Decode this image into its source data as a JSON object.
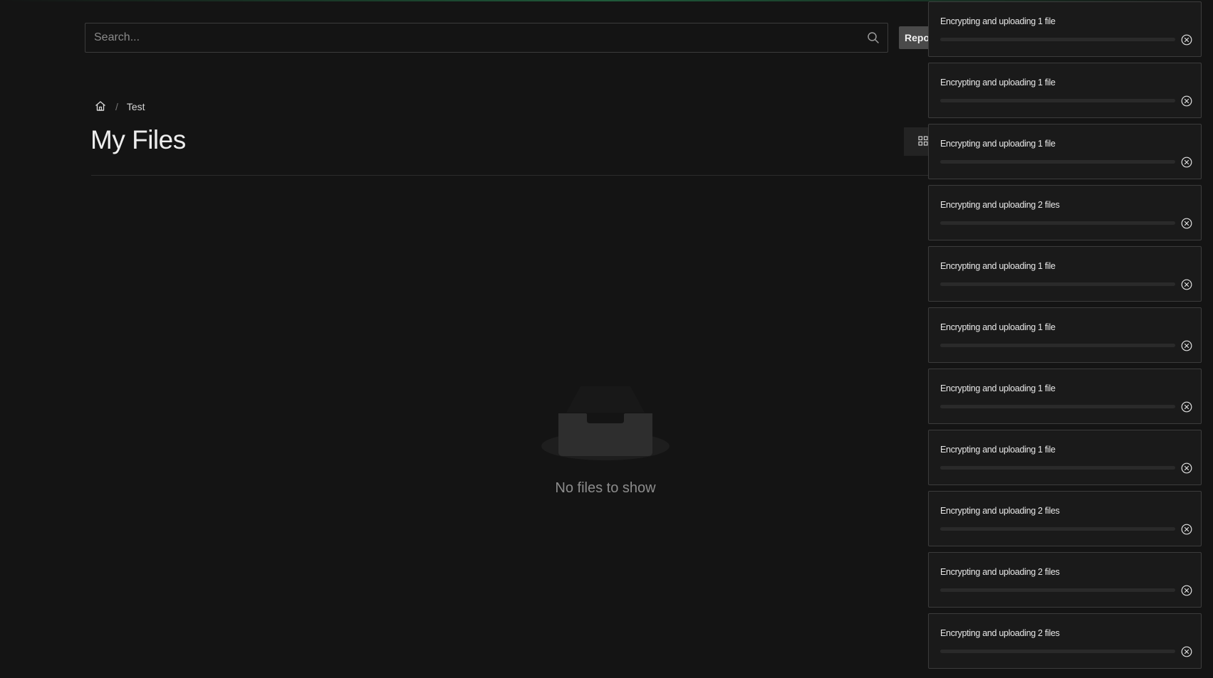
{
  "search": {
    "placeholder": "Search..."
  },
  "header": {
    "report_label": "Report"
  },
  "breadcrumb": {
    "items": [
      "Test"
    ]
  },
  "page": {
    "title": "My Files"
  },
  "empty_state": {
    "text": "No files to show"
  },
  "colors": {
    "background": "#141414",
    "toast_bg": "#1a1a1a",
    "border": "#3c3c3c",
    "accent": "#1f5a3a"
  },
  "toasts": [
    {
      "label": "Encrypting and uploading 1 file",
      "progress": 0
    },
    {
      "label": "Encrypting and uploading 1 file",
      "progress": 0
    },
    {
      "label": "Encrypting and uploading 1 file",
      "progress": 0
    },
    {
      "label": "Encrypting and uploading 2 files",
      "progress": 0
    },
    {
      "label": "Encrypting and uploading 1 file",
      "progress": 0
    },
    {
      "label": "Encrypting and uploading 1 file",
      "progress": 0
    },
    {
      "label": "Encrypting and uploading 1 file",
      "progress": 0
    },
    {
      "label": "Encrypting and uploading 1 file",
      "progress": 0
    },
    {
      "label": "Encrypting and uploading 2 files",
      "progress": 0
    },
    {
      "label": "Encrypting and uploading 2 files",
      "progress": 0
    },
    {
      "label": "Encrypting and uploading 2 files",
      "progress": 0
    }
  ]
}
